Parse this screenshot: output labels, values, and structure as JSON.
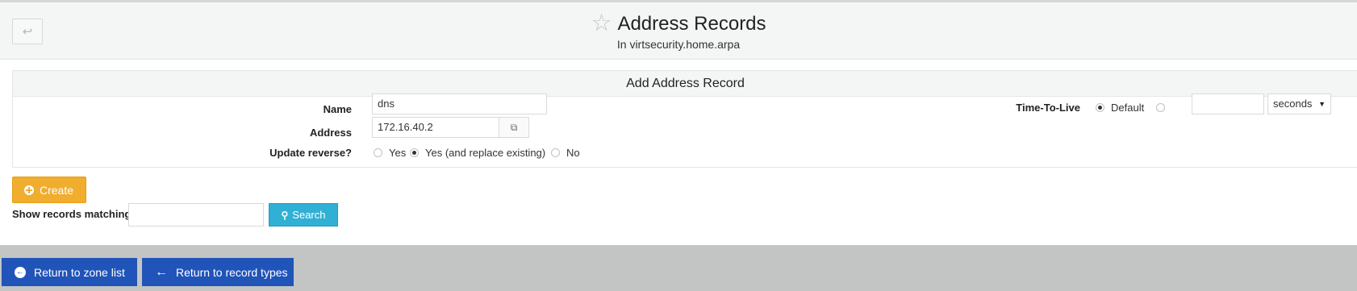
{
  "header": {
    "back_icon": "return-arrow-icon",
    "star_icon": "star-outline-icon",
    "title": "Address Records",
    "subtitle": "In virtsecurity.home.arpa"
  },
  "form": {
    "heading": "Add Address Record",
    "name_label": "Name",
    "name_value": "dns",
    "address_label": "Address",
    "address_value": "172.16.40.2",
    "update_reverse_label": "Update reverse?",
    "update_reverse_options": [
      "Yes",
      "Yes (and replace existing)",
      "No"
    ],
    "update_reverse_selected": "Yes (and replace existing)",
    "ttl_label": "Time-To-Live",
    "ttl_default_label": "Default",
    "ttl_selected": "Default",
    "ttl_value": "",
    "ttl_unit": "seconds"
  },
  "actions": {
    "create_label": "Create",
    "search_label": "Search",
    "show_matching_label": "Show records matching:",
    "search_value": ""
  },
  "footer": {
    "return_zone_label": "Return to zone list",
    "return_types_label": "Return to record types"
  },
  "colors": {
    "create": "#f0ad2e",
    "search": "#31b0d5",
    "nav": "#2154b8",
    "footer_bg": "#c3c5c5"
  }
}
